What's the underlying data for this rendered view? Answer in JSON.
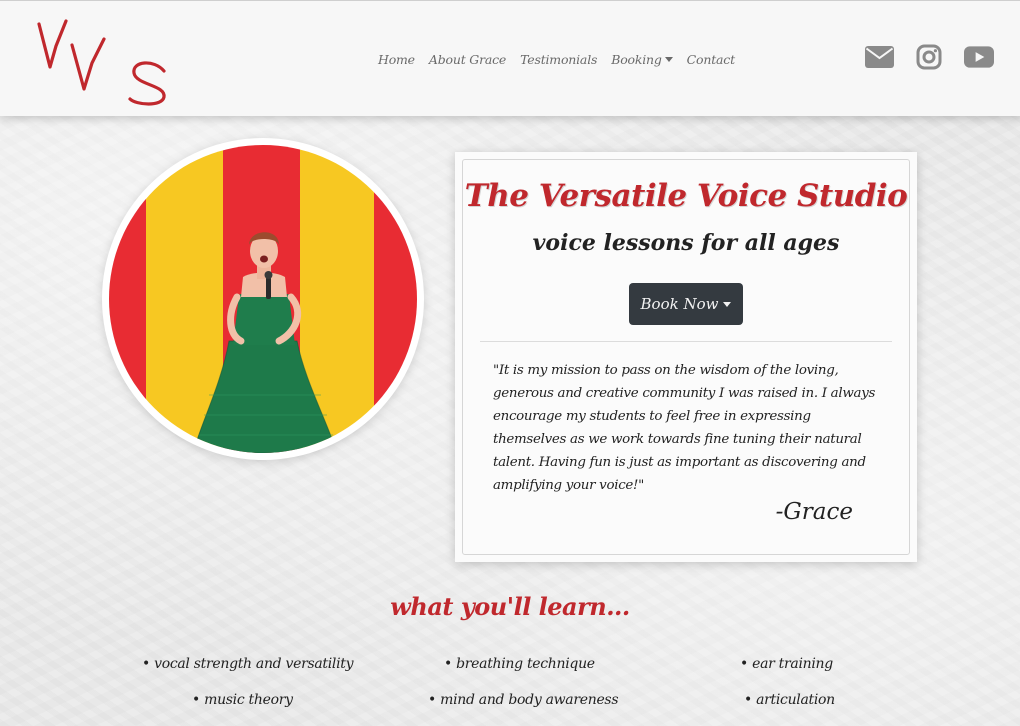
{
  "brand": {
    "logo_text": "VVS",
    "color": "#c0282d"
  },
  "nav": {
    "items": [
      {
        "label": "Home"
      },
      {
        "label": "About Grace"
      },
      {
        "label": "Testimonials"
      },
      {
        "label": "Booking",
        "dropdown": true
      },
      {
        "label": "Contact"
      }
    ]
  },
  "social": {
    "icons": [
      "envelope-icon",
      "instagram-icon",
      "youtube-icon"
    ],
    "color": "#8a8a8a"
  },
  "hero": {
    "title": "The Versatile Voice Studio",
    "subtitle": "voice lessons for all ages",
    "button_label": "Book Now",
    "quote": "\"It is my mission to pass on the wisdom of the loving, generous and creative community I was raised in. I always encourage my students to feel free in expressing themselves as we work towards fine tuning their natural talent. Having fun is just as important as discovering and amplifying your voice!\"",
    "signature": "-Grace"
  },
  "learn": {
    "title": "what you'll learn...",
    "items": [
      "vocal strength and versatility",
      "breathing technique",
      "ear training",
      "music theory",
      "mind and body awareness",
      "articulation"
    ]
  },
  "colors": {
    "accent": "#c0282d",
    "button_bg": "#343a40",
    "stripe_red": "#e8242b",
    "stripe_yellow": "#f7c61a",
    "dress_green": "#1e7a4a"
  }
}
